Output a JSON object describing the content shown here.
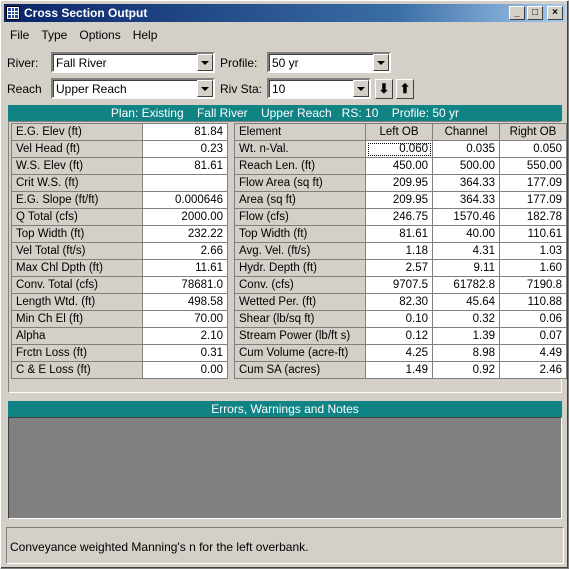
{
  "window": {
    "title": "Cross Section Output",
    "minimize": "_",
    "maximize": "□",
    "close": "×"
  },
  "menu": [
    "File",
    "Type",
    "Options",
    "Help"
  ],
  "selectors": {
    "river_label": "River:",
    "river_value": "Fall River",
    "profile_label": "Profile:",
    "profile_value": "50 yr",
    "reach_label": "Reach",
    "reach_value": "Upper Reach",
    "rivsta_label": "Riv Sta:",
    "rivsta_value": "10",
    "down_arrow": "⬇",
    "up_arrow": "⬆"
  },
  "plan_header": "Plan: Existing    Fall River    Upper Reach   RS: 10    Profile: 50 yr",
  "left_table": [
    [
      "E.G. Elev (ft)",
      "81.84"
    ],
    [
      "Vel Head (ft)",
      "0.23"
    ],
    [
      "W.S. Elev (ft)",
      "81.61"
    ],
    [
      "Crit W.S. (ft)",
      ""
    ],
    [
      "E.G. Slope (ft/ft)",
      "0.000646"
    ],
    [
      "Q Total (cfs)",
      "2000.00"
    ],
    [
      "Top Width (ft)",
      "232.22"
    ],
    [
      "Vel Total (ft/s)",
      "2.66"
    ],
    [
      "Max Chl Dpth (ft)",
      "11.61"
    ],
    [
      "Conv. Total (cfs)",
      "78681.0"
    ],
    [
      "Length Wtd. (ft)",
      "498.58"
    ],
    [
      "Min Ch El (ft)",
      "70.00"
    ],
    [
      "Alpha",
      "2.10"
    ],
    [
      "Frctn Loss (ft)",
      "0.31"
    ],
    [
      "C & E Loss (ft)",
      "0.00"
    ]
  ],
  "right_table": {
    "headers": [
      "Element",
      "Left OB",
      "Channel",
      "Right OB"
    ],
    "rows": [
      [
        "Wt. n-Val.",
        "0.060",
        "0.035",
        "0.050"
      ],
      [
        "Reach Len. (ft)",
        "450.00",
        "500.00",
        "550.00"
      ],
      [
        "Flow Area (sq ft)",
        "209.95",
        "364.33",
        "177.09"
      ],
      [
        "Area (sq ft)",
        "209.95",
        "364.33",
        "177.09"
      ],
      [
        "Flow (cfs)",
        "246.75",
        "1570.46",
        "182.78"
      ],
      [
        "Top Width (ft)",
        "81.61",
        "40.00",
        "110.61"
      ],
      [
        "Avg. Vel. (ft/s)",
        "1.18",
        "4.31",
        "1.03"
      ],
      [
        "Hydr. Depth (ft)",
        "2.57",
        "9.11",
        "1.60"
      ],
      [
        "Conv. (cfs)",
        "9707.5",
        "61782.8",
        "7190.8"
      ],
      [
        "Wetted Per. (ft)",
        "82.30",
        "45.64",
        "110.88"
      ],
      [
        "Shear (lb/sq ft)",
        "0.10",
        "0.32",
        "0.06"
      ],
      [
        "Stream Power (lb/ft s)",
        "0.12",
        "1.39",
        "0.07"
      ],
      [
        "Cum Volume (acre-ft)",
        "4.25",
        "8.98",
        "4.49"
      ],
      [
        "Cum SA (acres)",
        "1.49",
        "0.92",
        "2.46"
      ]
    ]
  },
  "errors_header": "Errors, Warnings and Notes",
  "status_text": "Conveyance weighted Manning's n for the left overbank."
}
